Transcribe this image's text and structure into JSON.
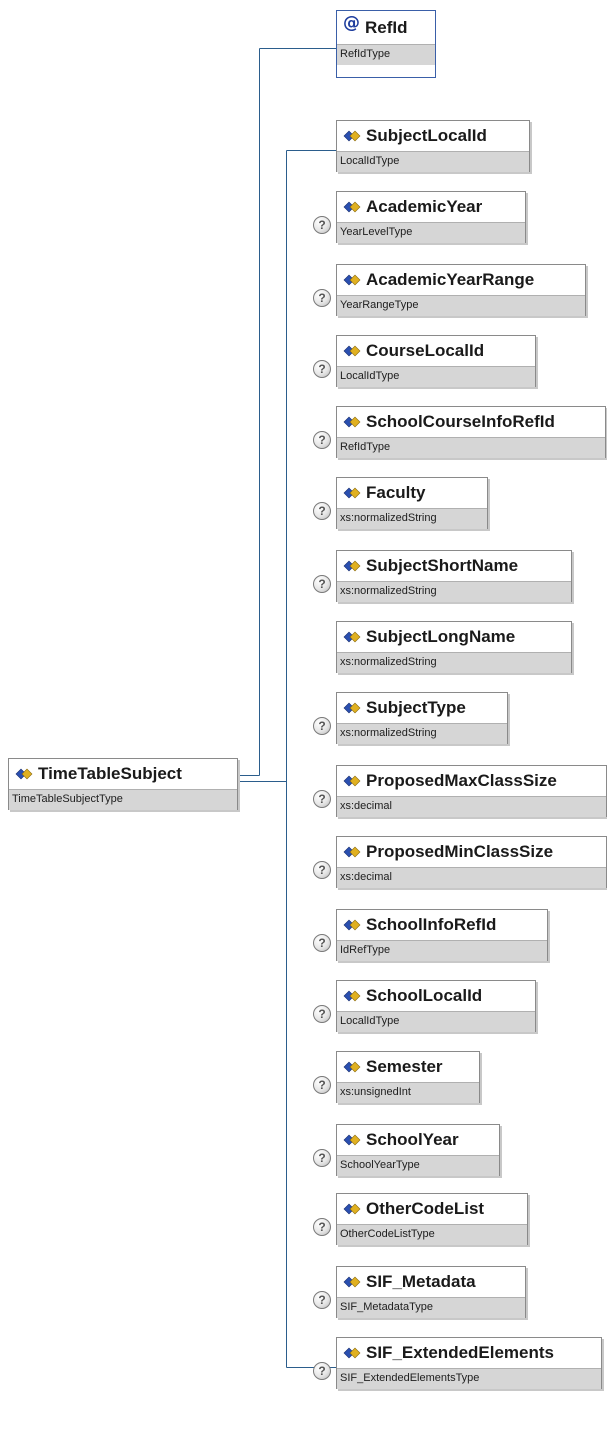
{
  "root": {
    "name": "TimeTableSubject",
    "type": "TimeTableSubjectType"
  },
  "attribute": {
    "name": "RefId",
    "type": "RefIdType"
  },
  "children": [
    {
      "name": "SubjectLocalId",
      "type": "LocalIdType",
      "optional": false
    },
    {
      "name": "AcademicYear",
      "type": "YearLevelType",
      "optional": true
    },
    {
      "name": "AcademicYearRange",
      "type": "YearRangeType",
      "optional": true
    },
    {
      "name": "CourseLocalId",
      "type": "LocalIdType",
      "optional": true
    },
    {
      "name": "SchoolCourseInfoRefId",
      "type": "RefIdType",
      "optional": true
    },
    {
      "name": "Faculty",
      "type": "xs:normalizedString",
      "optional": true
    },
    {
      "name": "SubjectShortName",
      "type": "xs:normalizedString",
      "optional": true
    },
    {
      "name": "SubjectLongName",
      "type": "xs:normalizedString",
      "optional": false
    },
    {
      "name": "SubjectType",
      "type": "xs:normalizedString",
      "optional": true
    },
    {
      "name": "ProposedMaxClassSize",
      "type": "xs:decimal",
      "optional": true
    },
    {
      "name": "ProposedMinClassSize",
      "type": "xs:decimal",
      "optional": true
    },
    {
      "name": "SchoolInfoRefId",
      "type": "IdRefType",
      "optional": true
    },
    {
      "name": "SchoolLocalId",
      "type": "LocalIdType",
      "optional": true
    },
    {
      "name": "Semester",
      "type": "xs:unsignedInt",
      "optional": true
    },
    {
      "name": "SchoolYear",
      "type": "SchoolYearType",
      "optional": true
    },
    {
      "name": "OtherCodeList",
      "type": "OtherCodeListType",
      "optional": true
    },
    {
      "name": "SIF_Metadata",
      "type": "SIF_MetadataType",
      "optional": true
    },
    {
      "name": "SIF_ExtendedElements",
      "type": "SIF_ExtendedElementsType",
      "optional": true
    }
  ],
  "icons": {
    "element": "element-diamond-icon",
    "attribute": "at-sign-icon",
    "optional": "question-mark-icon"
  },
  "colors": {
    "connector": "#2b5d8c",
    "attribute_border": "#3a5fa8",
    "type_band": "#d6d6d6",
    "icon_blue": "#2a4fb0",
    "icon_gold": "#e0b020"
  }
}
